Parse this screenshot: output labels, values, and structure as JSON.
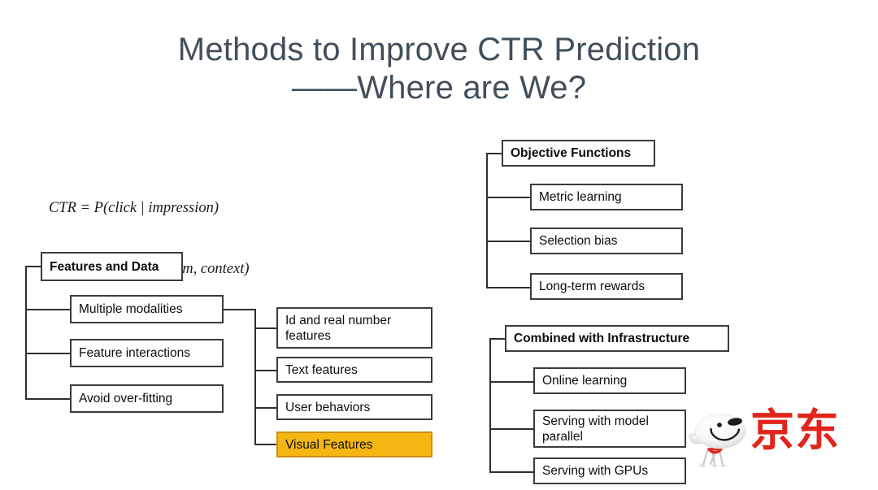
{
  "slide": {
    "title_line1": "Methods to Improve CTR Prediction",
    "title_line2": "——Where are We?",
    "title_color": "#414E5C",
    "background_color": "#FFFFFF"
  },
  "formula": {
    "line1": "CTR = P(click | impression)",
    "line2": "= f(query, user, item, context)"
  },
  "trees": {
    "features_and_data": {
      "root": "Features and Data",
      "children": [
        {
          "label": "Multiple modalities",
          "highlight": false
        },
        {
          "label": "Feature interactions",
          "highlight": false
        },
        {
          "label": "Avoid over-fitting",
          "highlight": false
        }
      ]
    },
    "modalities_detail": {
      "parent": "Multiple modalities",
      "children": [
        {
          "label": "Id and real number features",
          "highlight": false
        },
        {
          "label": "Text features",
          "highlight": false
        },
        {
          "label": "User behaviors",
          "highlight": false
        },
        {
          "label": "Visual Features",
          "highlight": true
        }
      ]
    },
    "objective_functions": {
      "root": "Objective Functions",
      "children": [
        {
          "label": "Metric learning",
          "highlight": false
        },
        {
          "label": "Selection bias",
          "highlight": false
        },
        {
          "label": "Long-term rewards",
          "highlight": false
        }
      ]
    },
    "combined_with_infrastructure": {
      "root": "Combined with Infrastructure",
      "children": [
        {
          "label": "Online learning",
          "highlight": false
        },
        {
          "label": "Serving with model parallel",
          "highlight": false
        },
        {
          "label": "Serving with GPUs",
          "highlight": false
        }
      ]
    }
  },
  "colors": {
    "highlight_fill": "#F6B612",
    "highlight_border": "#C8901A",
    "box_border": "#3B3B3B",
    "box_text": "#0D0D0D",
    "connector": "#2F2F2F",
    "brand_red": "#E1251B"
  },
  "logo": {
    "brand_text": "京东",
    "mascot_name": "joy-dog"
  }
}
